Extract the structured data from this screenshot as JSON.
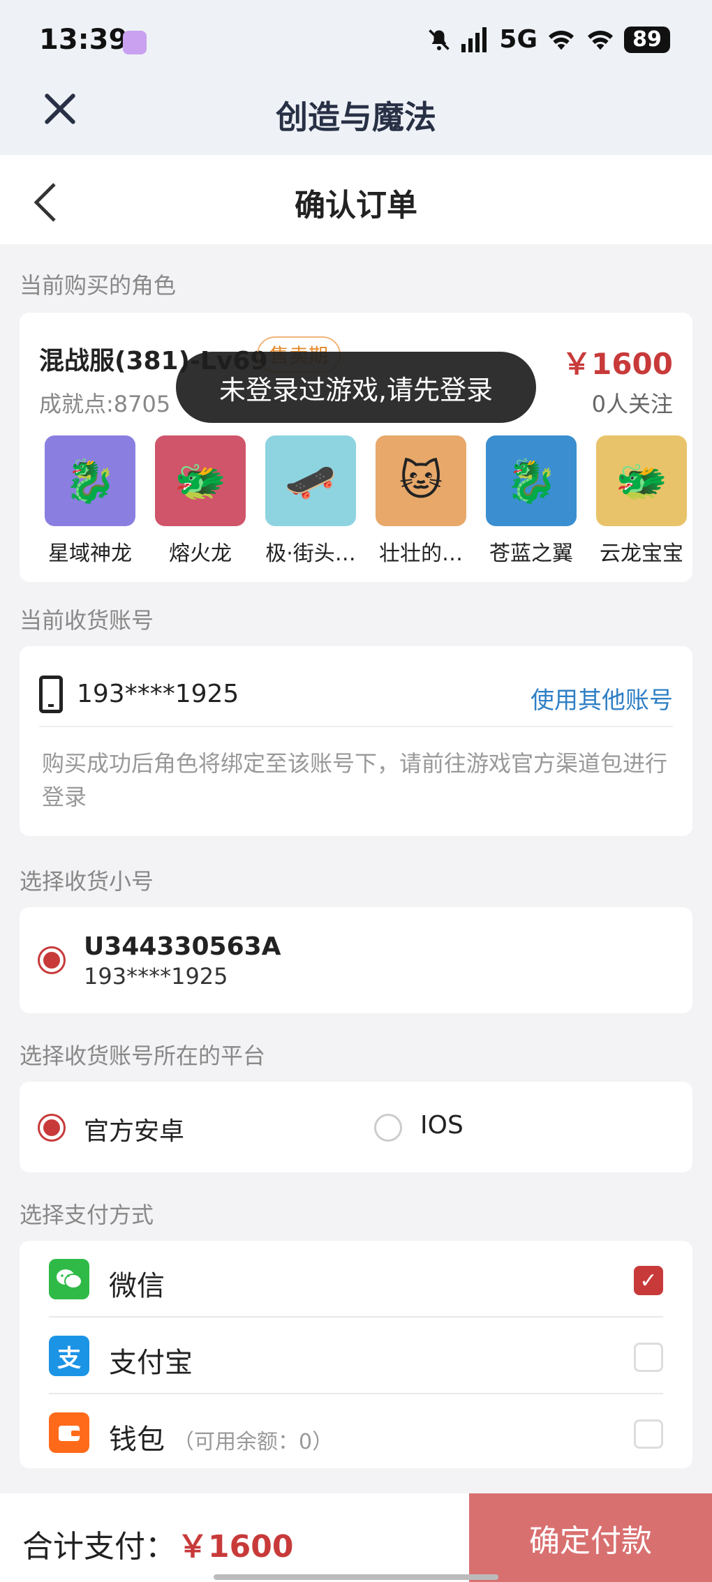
{
  "status_bar": {
    "time": "13:39",
    "network": "5G",
    "battery": "89"
  },
  "app_bar": {
    "title": "创造与魔法"
  },
  "nav": {
    "title": "确认订单"
  },
  "role_section": {
    "title": "当前购买的角色",
    "name": "混战服(381)-Lv69",
    "badge": "售卖期",
    "price": "￥1600",
    "points": "成就点:8705",
    "followers": "0人关注",
    "pets": [
      {
        "name": "星域神龙",
        "color": "#8a7fe0"
      },
      {
        "name": "熔火龙",
        "color": "#d0556a"
      },
      {
        "name": "极·街头…",
        "color": "#8ed3e0"
      },
      {
        "name": "壮壮的…",
        "color": "#e7a86a"
      },
      {
        "name": "苍蓝之翼",
        "color": "#3b8fd0"
      },
      {
        "name": "云龙宝宝",
        "color": "#e9c36a"
      }
    ]
  },
  "account_section": {
    "title": "当前收货账号",
    "account": "193****1925",
    "switch_label": "使用其他账号",
    "note": "购买成功后角色将绑定至该账号下，请前往游戏官方渠道包进行登录"
  },
  "sub_account_section": {
    "title": "选择收货小号",
    "id": "U344330563A",
    "phone": "193****1925"
  },
  "platform_section": {
    "title": "选择收货账号所在的平台",
    "options": [
      "官方安卓",
      "IOS"
    ]
  },
  "payment_section": {
    "title": "选择支付方式",
    "methods": [
      {
        "label": "微信",
        "sub": "",
        "color": "#2fba47",
        "icon": "wechat-icon"
      },
      {
        "label": "支付宝",
        "sub": "",
        "color": "#1c94e6",
        "icon": "alipay-icon"
      },
      {
        "label": "钱包",
        "sub": "（可用余额：0）",
        "color": "#ff6a1a",
        "icon": "wallet-icon"
      }
    ]
  },
  "bottom": {
    "total_label": "合计支付：",
    "total_price": "￥1600",
    "pay_button": "确定付款"
  },
  "toast": "未登录过游戏,请先登录"
}
